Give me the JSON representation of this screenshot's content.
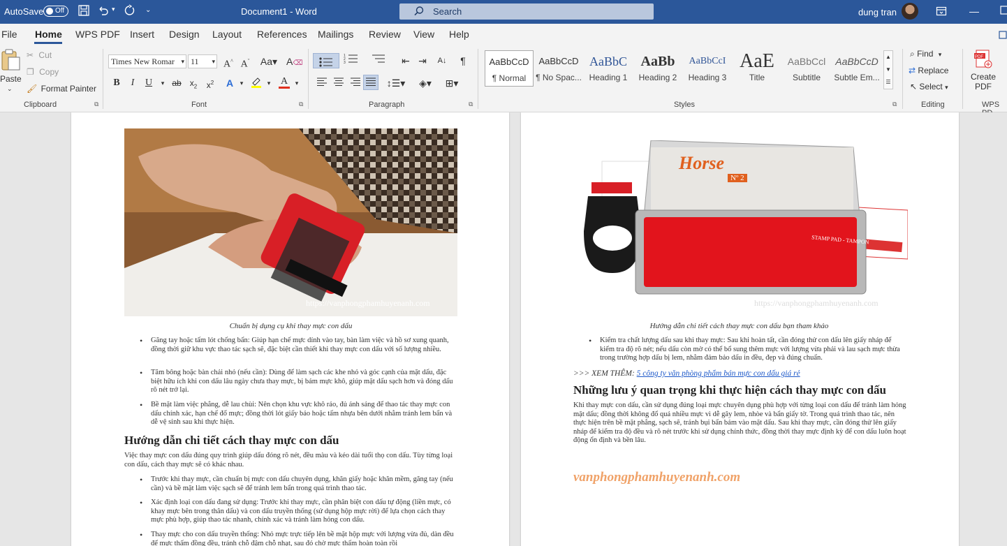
{
  "titlebar": {
    "autosave_label": "AutoSave",
    "autosave_state": "Off",
    "document_title": "Document1  -  Word",
    "search_placeholder": "Search",
    "user_name": "dung tran"
  },
  "tabs": [
    "File",
    "Home",
    "WPS PDF",
    "Insert",
    "Design",
    "Layout",
    "References",
    "Mailings",
    "Review",
    "View",
    "Help"
  ],
  "clipboard": {
    "paste": "Paste",
    "cut": "Cut",
    "copy": "Copy",
    "format_painter": "Format Painter",
    "label": "Clipboard"
  },
  "font": {
    "name": "Times New Romar",
    "size": "11",
    "label": "Font"
  },
  "paragraph": {
    "label": "Paragraph"
  },
  "styles": {
    "label": "Styles",
    "items": [
      {
        "preview": "AaBbCcD",
        "name": "¶ Normal"
      },
      {
        "preview": "AaBbCcD",
        "name": "¶ No Spac..."
      },
      {
        "preview": "AaBbC",
        "name": "Heading 1"
      },
      {
        "preview": "AaBb",
        "name": "Heading 2"
      },
      {
        "preview": "AaBbCcI",
        "name": "Heading 3"
      },
      {
        "preview": "AaE",
        "name": "Title"
      },
      {
        "preview": "AaBbCcl",
        "name": "Subtitle"
      },
      {
        "preview": "AaBbCcD",
        "name": "Subtle Em..."
      }
    ]
  },
  "editing": {
    "find": "Find",
    "replace": "Replace",
    "select": "Select",
    "label": "Editing"
  },
  "wpspdf": {
    "create": "Create",
    "pdf": "PDF",
    "label": "WPS PD"
  },
  "page1": {
    "watermark": "https://vanphongphamhuyenanh.com",
    "caption": "Chuẩn bị dụng cụ khi thay mực con dấu",
    "bullets1": [
      "Găng tay hoặc tấm lót chống bẩn: Giúp hạn chế mực dính vào tay, bàn làm việc và hồ sơ xung quanh, đồng thời giữ khu vực thao tác sạch sẽ, đặc biệt cần thiết khi thay mực con dấu với số lượng nhiều.",
      "Tăm bông hoặc bàn chải nhỏ (nếu cần): Dùng để làm sạch các khe nhỏ và góc cạnh của mặt dấu, đặc biệt hữu ích khi con dấu lâu ngày chưa thay mực, bị bám mực khô, giúp mặt dấu sạch hơn và đóng dấu rõ nét trở lại.",
      "Bề mặt làm việc phẳng, dễ lau chùi: Nên chọn khu vực khô ráo, đủ ánh sáng để thao tác thay mực con dấu chính xác, hạn chế đổ mực; đồng thời lót giấy báo hoặc tấm nhựa bên dưới nhằm tránh lem bẩn và dễ vệ sinh sau khi thực hiện."
    ],
    "heading": "Hướng dẫn chi tiết cách thay mực con dấu",
    "intro": "Việc thay mực con dấu đúng quy trình giúp dấu đóng rõ nét, đều màu và kéo dài tuổi thọ con dấu. Tùy từng loại con dấu, cách thay mực sẽ có khác nhau.",
    "bullets2": [
      "Trước khi thay mực, cần chuẩn bị mực con dấu chuyên dụng, khăn giấy hoặc khăn mềm, găng tay (nếu cần) và bề mặt làm việc sạch sẽ để tránh lem bẩn trong quá trình thao tác.",
      "Xác định loại con dấu đang sử dụng: Trước khi thay mực, cần phân biệt con dấu tự động (liền mực, có khay mực bên trong thân dấu) và con dấu truyền thống (sử dụng hộp mực rời) để lựa chọn cách thay mực phù hợp, giúp thao tác nhanh, chính xác và tránh làm hỏng con dấu.",
      "Thay mực cho con dấu truyền thống: Nhỏ mực trực tiếp lên bề mặt hộp mực với lượng vừa đủ, dàn đều để mực thấm đồng đều, tránh chỗ đậm chỗ nhạt, sau đó chờ mực thấm hoàn toàn rồi"
    ]
  },
  "page2": {
    "product": {
      "brand": "Horse",
      "no": "Nº 2",
      "pad_label": "STAMP PAD - TAMPON"
    },
    "watermark": "https://vanphongphamhuyenanh.com",
    "caption": "Hướng dẫn chi tiết cách thay mực con dấu bạn tham khảo",
    "bullet": "Kiểm tra chất lượng dấu sau khi thay mực: Sau khi hoàn tất, cần đóng thử con dấu lên giấy nháp để kiểm tra độ rõ nét; nếu dấu còn mờ có thể bổ sung thêm mực với lượng vừa phải và lau sạch mực thừa trong trường hợp dấu bị lem, nhằm đảm bảo dấu in đều, đẹp và đúng chuẩn.",
    "see_more_prefix": ">>> XEM THÊM: ",
    "see_more_link": "5 công ty văn phòng phẩm bán mực con dấu giá rẻ ",
    "heading": "Những lưu ý quan trọng khi thực hiện cách thay mực con dấu",
    "para": "Khi thay mực con dấu, cần sử dụng đúng loại mực chuyên dụng phù hợp với từng loại con dấu để tránh làm hỏng mặt dấu; đồng thời không đổ quá nhiều mực vì dễ gây lem, nhòe và bẩn giấy tờ. Trong quá trình thao tác, nên thực hiện trên bề mặt phẳng, sạch sẽ, tránh bụi bẩn bám vào mặt dấu. Sau khi thay mực, cần đóng thử lên giấy nháp để kiểm tra độ đều và rõ nét trước khi sử dụng chính thức, đồng thời thay mực định kỳ để con dấu luôn hoạt động ổn định và bền lâu.",
    "site": "vanphongphamhuyenanh.com"
  },
  "colors": {
    "titlebar": "#2b579a",
    "ribbon": "#f3f3f3",
    "link": "#1a56c8",
    "site": "#f0a268"
  }
}
